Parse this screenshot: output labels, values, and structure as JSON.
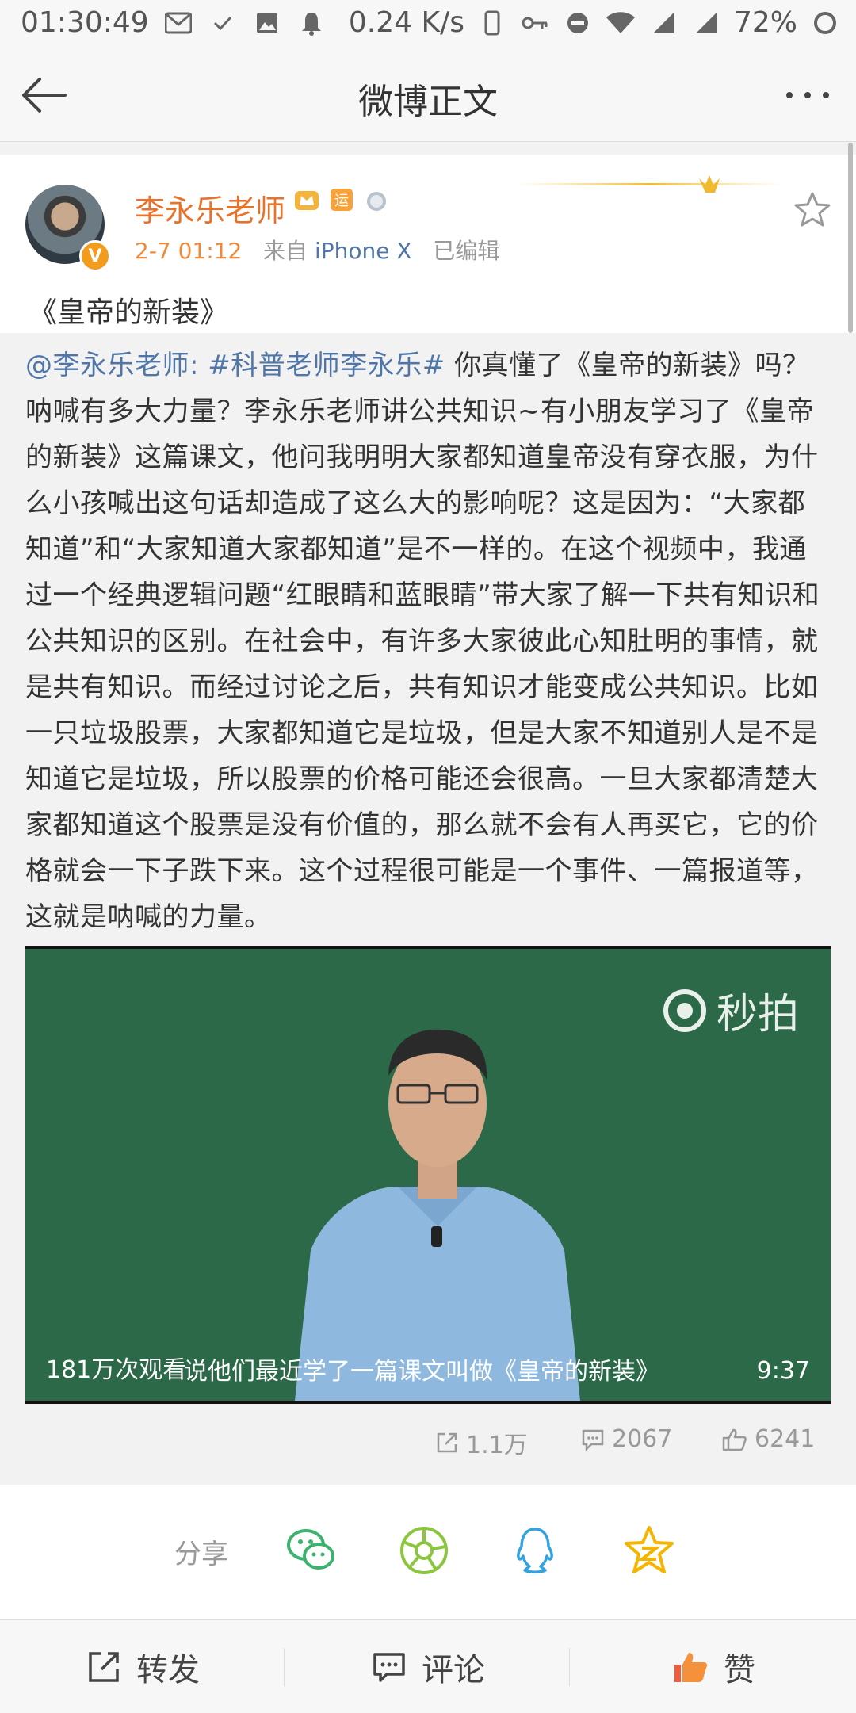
{
  "status_bar": {
    "time": "01:30:49",
    "net_speed": "0.24 K/s",
    "battery": "72%",
    "icons": [
      "gmail-icon",
      "check-icon",
      "image-icon",
      "bell-icon",
      "phone-icon",
      "key-icon",
      "dnd-icon",
      "wifi-icon",
      "signal-icon",
      "signal-icon",
      "battery-icon"
    ]
  },
  "header": {
    "title": "微博正文"
  },
  "post": {
    "username": "李永乐老师",
    "time": "2-7 01:12",
    "source_prefix": "来自",
    "source": "iPhone X",
    "edited": "已编辑",
    "title": "《皇帝的新装》",
    "mention": "@李永乐老师:",
    "tag": "#科普老师李永乐#",
    "text": " 你真懂了《皇帝的新装》吗？呐喊有多大力量？李永乐老师讲公共知识~有小朋友学习了《皇帝的新装》这篇课文，他问我明明大家都知道皇帝没有穿衣服，为什么小孩喊出这句话却造成了这么大的影响呢？这是因为：“大家都知道”和“大家知道大家都知道”是不一样的。在这个视频中，我通过一个经典逻辑问题“红眼睛和蓝眼睛”带大家了解一下共有知识和公共知识的区别。在社会中，有许多大家彼此心知肚明的事情，就是共有知识。而经过讨论之后，共有知识才能变成公共知识。比如一只垃圾股票，大家都知道它是垃圾，但是大家不知道别人是不是知道它是垃圾，所以股票的价格可能还会很高。一旦大家都清楚大家都知道这个股票是没有价值的，那么就不会有人再买它，它的价格就会一下子跌下来。这个过程很可能是一个事件、一篇报道等，这就是呐喊的力量。"
  },
  "video": {
    "watermark": "秒拍",
    "views": "181万次观看",
    "subtitle": "说他们最近学了一篇课文叫做《皇帝的新装》",
    "duration": "9:37"
  },
  "stats": {
    "reposts": "1.1万",
    "comments": "2067",
    "likes": "6241"
  },
  "share": {
    "label": "分享"
  },
  "bottom_bar": {
    "repost": "转发",
    "comment": "评论",
    "like": "赞"
  },
  "colors": {
    "accent_orange": "#e8722a",
    "link_blue": "#5076a8",
    "board_green": "#2f6e4d"
  }
}
